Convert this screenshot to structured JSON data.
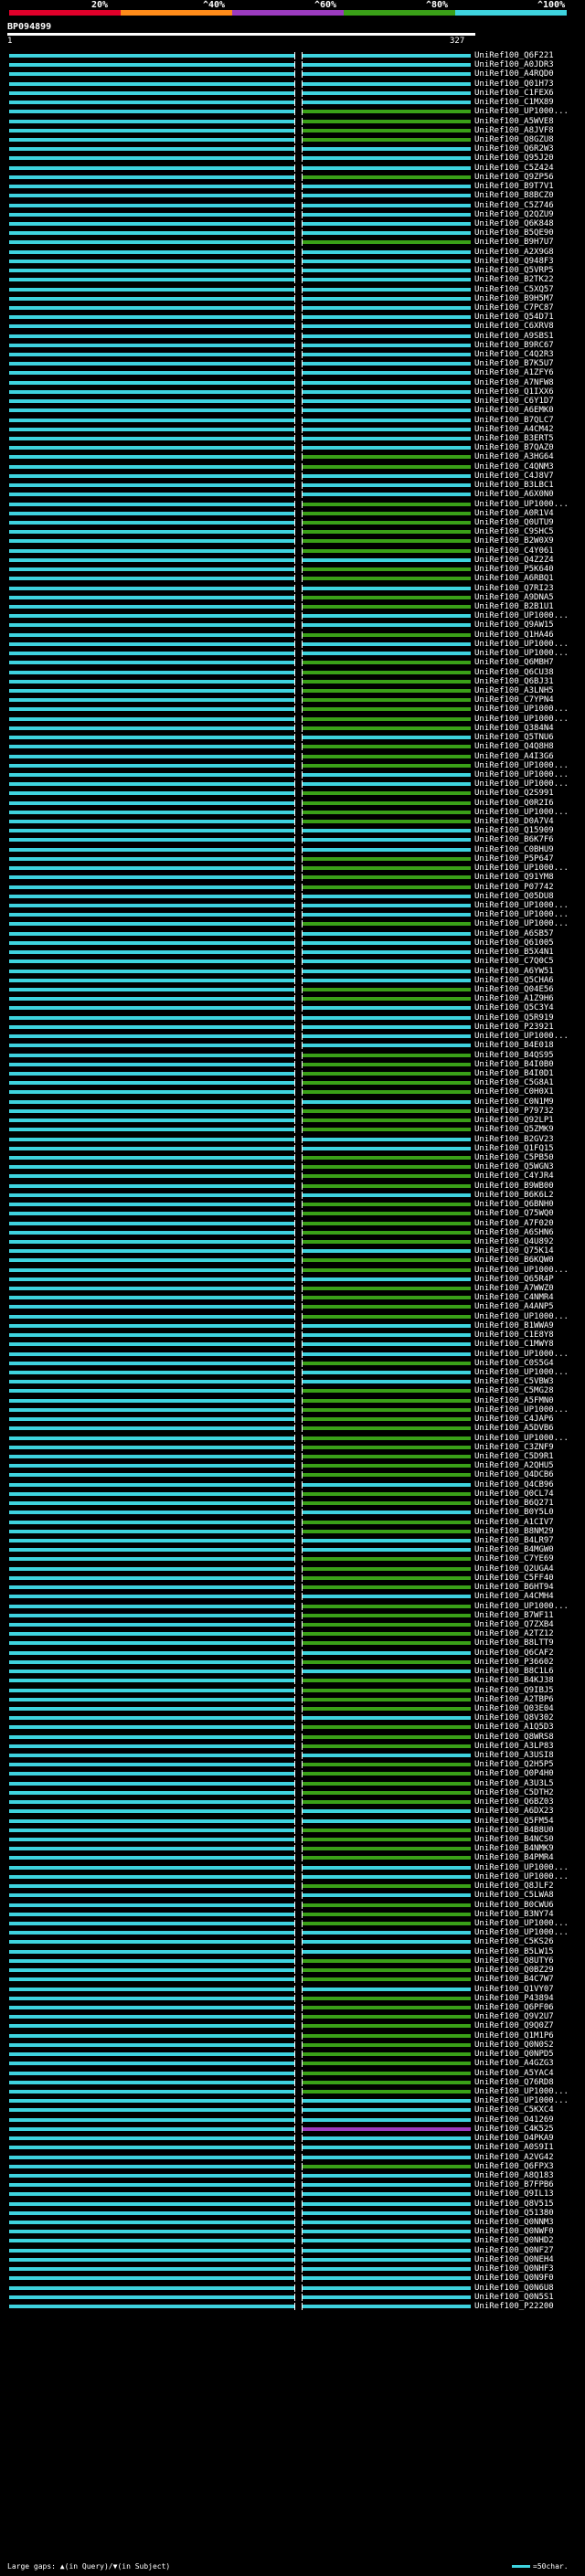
{
  "colors": {
    "background": "#000000",
    "scale": [
      "#e0002a",
      "#ff8c1a",
      "#9b3bbf",
      "#3aa018",
      "#3ed3de"
    ],
    "match_cyan": "#3ed3de",
    "match_green": "#3aa018",
    "match_purple": "#9b3bbf",
    "gap": "#000000"
  },
  "scale_labels": [
    "20%",
    "^40%",
    "^60%",
    "^80%",
    "^100%"
  ],
  "query": {
    "id": "BP094899",
    "start": "1",
    "end": "327"
  },
  "alignments": [
    {
      "label": "UniRef100_Q6F221",
      "color": "cyan"
    },
    {
      "label": "UniRef100_A0JDR3",
      "color": "cyan"
    },
    {
      "label": "UniRef100_A4RQD0",
      "color": "cyan"
    },
    {
      "label": "UniRef100_Q01H73",
      "color": "cyan"
    },
    {
      "label": "UniRef100_C1FEX6",
      "color": "cyan"
    },
    {
      "label": "UniRef100_C1MX89",
      "color": "cyan"
    },
    {
      "label": "UniRef100_UP1000...",
      "color": "green"
    },
    {
      "label": "UniRef100_A5WVE8",
      "color": "green"
    },
    {
      "label": "UniRef100_A8JVF8",
      "color": "green"
    },
    {
      "label": "UniRef100_Q8GZU8",
      "color": "green"
    },
    {
      "label": "UniRef100_Q6R2W3",
      "color": "cyan"
    },
    {
      "label": "UniRef100_Q95J20",
      "color": "cyan"
    },
    {
      "label": "UniRef100_C5Z424",
      "color": "cyan"
    },
    {
      "label": "UniRef100_Q9ZP56",
      "color": "green"
    },
    {
      "label": "UniRef100_B9T7V1",
      "color": "cyan"
    },
    {
      "label": "UniRef100_B8BCZ0",
      "color": "cyan"
    },
    {
      "label": "UniRef100_C5Z746",
      "color": "cyan"
    },
    {
      "label": "UniRef100_Q2QZU9",
      "color": "cyan"
    },
    {
      "label": "UniRef100_Q6K848",
      "color": "cyan"
    },
    {
      "label": "UniRef100_B5QE90",
      "color": "cyan"
    },
    {
      "label": "UniRef100_B9H7U7",
      "color": "green"
    },
    {
      "label": "UniRef100_A2X9G8",
      "color": "cyan"
    },
    {
      "label": "UniRef100_Q948F3",
      "color": "cyan"
    },
    {
      "label": "UniRef100_Q5VRP5",
      "color": "cyan"
    },
    {
      "label": "UniRef100_B2TK22",
      "color": "cyan"
    },
    {
      "label": "UniRef100_C5XQ57",
      "color": "cyan"
    },
    {
      "label": "UniRef100_B9H5M7",
      "color": "cyan"
    },
    {
      "label": "UniRef100_C7PC87",
      "color": "cyan"
    },
    {
      "label": "UniRef100_Q54D71",
      "color": "cyan"
    },
    {
      "label": "UniRef100_C6XRV8",
      "color": "cyan"
    },
    {
      "label": "UniRef100_A9SBS1",
      "color": "cyan"
    },
    {
      "label": "UniRef100_B9RC67",
      "color": "cyan"
    },
    {
      "label": "UniRef100_C4Q2R3",
      "color": "cyan"
    },
    {
      "label": "UniRef100_B7K5U7",
      "color": "cyan"
    },
    {
      "label": "UniRef100_A1ZFY6",
      "color": "cyan"
    },
    {
      "label": "UniRef100_A7NFW8",
      "color": "cyan"
    },
    {
      "label": "UniRef100_Q1IXX6",
      "color": "cyan"
    },
    {
      "label": "UniRef100_C6Y1D7",
      "color": "cyan"
    },
    {
      "label": "UniRef100_A6EMK0",
      "color": "cyan"
    },
    {
      "label": "UniRef100_B7QLC7",
      "color": "cyan"
    },
    {
      "label": "UniRef100_A4CM42",
      "color": "cyan"
    },
    {
      "label": "UniRef100_B3ERT5",
      "color": "cyan"
    },
    {
      "label": "UniRef100_B7QAZ0",
      "color": "cyan"
    },
    {
      "label": "UniRef100_A3HG64",
      "color": "green"
    },
    {
      "label": "UniRef100_C4QNM3",
      "color": "green"
    },
    {
      "label": "UniRef100_C4J8V7",
      "color": "cyan"
    },
    {
      "label": "UniRef100_B3LBC1",
      "color": "cyan"
    },
    {
      "label": "UniRef100_A6X0N0",
      "color": "cyan"
    },
    {
      "label": "UniRef100_UP1000...",
      "color": "green"
    },
    {
      "label": "UniRef100_A0R1V4",
      "color": "green"
    },
    {
      "label": "UniRef100_Q0UTU9",
      "color": "green"
    },
    {
      "label": "UniRef100_C9SHC5",
      "color": "green"
    },
    {
      "label": "UniRef100_B2W0X9",
      "color": "green"
    },
    {
      "label": "UniRef100_C4Y061",
      "color": "green"
    },
    {
      "label": "UniRef100_Q4Z2Z4",
      "color": "cyan"
    },
    {
      "label": "UniRef100_P5K640",
      "color": "green"
    },
    {
      "label": "UniRef100_A6RBQ1",
      "color": "green"
    },
    {
      "label": "UniRef100_Q7RI23",
      "color": "cyan"
    },
    {
      "label": "UniRef100_A9DNA5",
      "color": "green"
    },
    {
      "label": "UniRef100_B2B1U1",
      "color": "green"
    },
    {
      "label": "UniRef100_UP1000...",
      "color": "cyan"
    },
    {
      "label": "UniRef100_Q9AW15",
      "color": "cyan"
    },
    {
      "label": "UniRef100_Q1HA46",
      "color": "green"
    },
    {
      "label": "UniRef100_UP1000...",
      "color": "cyan"
    },
    {
      "label": "UniRef100_UP1000...",
      "color": "cyan"
    },
    {
      "label": "UniRef100_Q6MBH7",
      "color": "green"
    },
    {
      "label": "UniRef100_Q6CU38",
      "color": "green"
    },
    {
      "label": "UniRef100_Q6BJ31",
      "color": "green"
    },
    {
      "label": "UniRef100_A3LNH5",
      "color": "green"
    },
    {
      "label": "UniRef100_C7YPN4",
      "color": "green"
    },
    {
      "label": "UniRef100_UP1000...",
      "color": "green"
    },
    {
      "label": "UniRef100_UP1000...",
      "color": "green"
    },
    {
      "label": "UniRef100_Q384N4",
      "color": "green"
    },
    {
      "label": "UniRef100_Q5TNU6",
      "color": "cyan"
    },
    {
      "label": "UniRef100_Q4Q8H8",
      "color": "green"
    },
    {
      "label": "UniRef100_A4I3G6",
      "color": "green"
    },
    {
      "label": "UniRef100_UP1000...",
      "color": "green"
    },
    {
      "label": "UniRef100_UP1000...",
      "color": "cyan"
    },
    {
      "label": "UniRef100_UP1000...",
      "color": "cyan"
    },
    {
      "label": "UniRef100_Q2S991",
      "color": "green"
    },
    {
      "label": "UniRef100_Q0R2I6",
      "color": "green"
    },
    {
      "label": "UniRef100_UP1000...",
      "color": "green"
    },
    {
      "label": "UniRef100_D0A7V4",
      "color": "green"
    },
    {
      "label": "UniRef100_Q15909",
      "color": "cyan"
    },
    {
      "label": "UniRef100_B6K7F6",
      "color": "cyan"
    },
    {
      "label": "UniRef100_C0BHU9",
      "color": "cyan"
    },
    {
      "label": "UniRef100_P5P647",
      "color": "green"
    },
    {
      "label": "UniRef100_UP1000...",
      "color": "green"
    },
    {
      "label": "UniRef100_Q91YM8",
      "color": "green"
    },
    {
      "label": "UniRef100_P07742",
      "color": "green"
    },
    {
      "label": "UniRef100_Q05DU8",
      "color": "cyan"
    },
    {
      "label": "UniRef100_UP1000...",
      "color": "cyan"
    },
    {
      "label": "UniRef100_UP1000...",
      "color": "cyan"
    },
    {
      "label": "UniRef100_UP1000...",
      "color": "green"
    },
    {
      "label": "UniRef100_A6SB57",
      "color": "cyan"
    },
    {
      "label": "UniRef100_Q61005",
      "color": "cyan"
    },
    {
      "label": "UniRef100_B5X4N1",
      "color": "cyan"
    },
    {
      "label": "UniRef100_C7Q0C5",
      "color": "cyan"
    },
    {
      "label": "UniRef100_A6YW51",
      "color": "cyan"
    },
    {
      "label": "UniRef100_Q5CHA6",
      "color": "cyan"
    },
    {
      "label": "UniRef100_Q04E56",
      "color": "green"
    },
    {
      "label": "UniRef100_A1Z9H6",
      "color": "green"
    },
    {
      "label": "UniRef100_Q5C3Y4",
      "color": "cyan"
    },
    {
      "label": "UniRef100_Q5R919",
      "color": "cyan"
    },
    {
      "label": "UniRef100_P23921",
      "color": "cyan"
    },
    {
      "label": "UniRef100_UP1000...",
      "color": "cyan"
    },
    {
      "label": "UniRef100_B4E018",
      "color": "cyan"
    },
    {
      "label": "UniRef100_B4QS95",
      "color": "green"
    },
    {
      "label": "UniRef100_B4I0B0",
      "color": "green"
    },
    {
      "label": "UniRef100_B4I0D1",
      "color": "green"
    },
    {
      "label": "UniRef100_C5G8A1",
      "color": "green"
    },
    {
      "label": "UniRef100_C0H0X1",
      "color": "green"
    },
    {
      "label": "UniRef100_C0N1M9",
      "color": "cyan"
    },
    {
      "label": "UniRef100_P79732",
      "color": "green"
    },
    {
      "label": "UniRef100_Q92LP1",
      "color": "green"
    },
    {
      "label": "UniRef100_Q5ZMK9",
      "color": "green"
    },
    {
      "label": "UniRef100_B2GV23",
      "color": "cyan"
    },
    {
      "label": "UniRef100_Q1FQ15",
      "color": "cyan"
    },
    {
      "label": "UniRef100_C5PB50",
      "color": "green"
    },
    {
      "label": "UniRef100_Q5WGN3",
      "color": "green"
    },
    {
      "label": "UniRef100_C4YJR4",
      "color": "green"
    },
    {
      "label": "UniRef100_B9WB00",
      "color": "green"
    },
    {
      "label": "UniRef100_B6K6L2",
      "color": "cyan"
    },
    {
      "label": "UniRef100_Q6BNH0",
      "color": "green"
    },
    {
      "label": "UniRef100_Q75WQ0",
      "color": "green"
    },
    {
      "label": "UniRef100_A7F020",
      "color": "green"
    },
    {
      "label": "UniRef100_A6SHN6",
      "color": "green"
    },
    {
      "label": "UniRef100_Q4U892",
      "color": "green"
    },
    {
      "label": "UniRef100_Q75K14",
      "color": "cyan"
    },
    {
      "label": "UniRef100_B6KQW0",
      "color": "green"
    },
    {
      "label": "UniRef100_UP1000...",
      "color": "green"
    },
    {
      "label": "UniRef100_Q65R4P",
      "color": "cyan"
    },
    {
      "label": "UniRef100_A7WWZ0",
      "color": "green"
    },
    {
      "label": "UniRef100_C4NMR4",
      "color": "green"
    },
    {
      "label": "UniRef100_A4ANP5",
      "color": "green"
    },
    {
      "label": "UniRef100_UP1000...",
      "color": "green"
    },
    {
      "label": "UniRef100_B1WWA9",
      "color": "cyan"
    },
    {
      "label": "UniRef100_C1E8Y8",
      "color": "cyan"
    },
    {
      "label": "UniRef100_C1MWY8",
      "color": "cyan"
    },
    {
      "label": "UniRef100_UP1000...",
      "color": "cyan"
    },
    {
      "label": "UniRef100_C0S5G4",
      "color": "green"
    },
    {
      "label": "UniRef100_UP1000...",
      "color": "cyan"
    },
    {
      "label": "UniRef100_C5VBW3",
      "color": "cyan"
    },
    {
      "label": "UniRef100_C5MG28",
      "color": "green"
    },
    {
      "label": "UniRef100_A5FMN0",
      "color": "green"
    },
    {
      "label": "UniRef100_UP1000...",
      "color": "green"
    },
    {
      "label": "UniRef100_C4JAP6",
      "color": "green"
    },
    {
      "label": "UniRef100_A5DVB6",
      "color": "green"
    },
    {
      "label": "UniRef100_UP1000...",
      "color": "green"
    },
    {
      "label": "UniRef100_C3ZNF9",
      "color": "green"
    },
    {
      "label": "UniRef100_C5D9R1",
      "color": "green"
    },
    {
      "label": "UniRef100_A2QHU5",
      "color": "green"
    },
    {
      "label": "UniRef100_Q4DCB6",
      "color": "green"
    },
    {
      "label": "UniRef100_Q4CB96",
      "color": "cyan"
    },
    {
      "label": "UniRef100_Q0CL74",
      "color": "green"
    },
    {
      "label": "UniRef100_B6Q271",
      "color": "green"
    },
    {
      "label": "UniRef100_B0Y5L0",
      "color": "cyan"
    },
    {
      "label": "UniRef100_A1CIV7",
      "color": "green"
    },
    {
      "label": "UniRef100_B8NM29",
      "color": "green"
    },
    {
      "label": "UniRef100_B4LR97",
      "color": "cyan"
    },
    {
      "label": "UniRef100_B4MGW0",
      "color": "cyan"
    },
    {
      "label": "UniRef100_C7YE69",
      "color": "green"
    },
    {
      "label": "UniRef100_Q2UGA4",
      "color": "green"
    },
    {
      "label": "UniRef100_C5FF40",
      "color": "green"
    },
    {
      "label": "UniRef100_B6HT94",
      "color": "green"
    },
    {
      "label": "UniRef100_A4CMH4",
      "color": "cyan"
    },
    {
      "label": "UniRef100_UP1000...",
      "color": "green"
    },
    {
      "label": "UniRef100_B7WF11",
      "color": "green"
    },
    {
      "label": "UniRef100_Q7ZXB4",
      "color": "green"
    },
    {
      "label": "UniRef100_A2TZ12",
      "color": "green"
    },
    {
      "label": "UniRef100_B8LTT9",
      "color": "green"
    },
    {
      "label": "UniRef100_Q6CAF2",
      "color": "cyan"
    },
    {
      "label": "UniRef100_P36602",
      "color": "green"
    },
    {
      "label": "UniRef100_B8C1L6",
      "color": "cyan"
    },
    {
      "label": "UniRef100_B4KJ38",
      "color": "green"
    },
    {
      "label": "UniRef100_Q9IBJ5",
      "color": "green"
    },
    {
      "label": "UniRef100_A2TBP6",
      "color": "green"
    },
    {
      "label": "UniRef100_Q03E04",
      "color": "green"
    },
    {
      "label": "UniRef100_Q8V302",
      "color": "cyan"
    },
    {
      "label": "UniRef100_A1Q5D3",
      "color": "green"
    },
    {
      "label": "UniRef100_Q8WRS8",
      "color": "green"
    },
    {
      "label": "UniRef100_A3LP83",
      "color": "green"
    },
    {
      "label": "UniRef100_A3USI8",
      "color": "cyan"
    },
    {
      "label": "UniRef100_Q2H5P5",
      "color": "green"
    },
    {
      "label": "UniRef100_Q0P4H0",
      "color": "green"
    },
    {
      "label": "UniRef100_A3U3L5",
      "color": "green"
    },
    {
      "label": "UniRef100_C5DTH2",
      "color": "green"
    },
    {
      "label": "UniRef100_Q6BZ03",
      "color": "green"
    },
    {
      "label": "UniRef100_A6DX23",
      "color": "cyan"
    },
    {
      "label": "UniRef100_Q5FM54",
      "color": "cyan"
    },
    {
      "label": "UniRef100_B4B8U0",
      "color": "green"
    },
    {
      "label": "UniRef100_B4NCS0",
      "color": "green"
    },
    {
      "label": "UniRef100_B4NMK9",
      "color": "green"
    },
    {
      "label": "UniRef100_B4PMR4",
      "color": "green"
    },
    {
      "label": "UniRef100_UP1000...",
      "color": "cyan"
    },
    {
      "label": "UniRef100_UP1000...",
      "color": "cyan"
    },
    {
      "label": "UniRef100_Q8JLF2",
      "color": "green"
    },
    {
      "label": "UniRef100_C5LWA8",
      "color": "cyan"
    },
    {
      "label": "UniRef100_B0CWU6",
      "color": "green"
    },
    {
      "label": "UniRef100_B3NY74",
      "color": "green"
    },
    {
      "label": "UniRef100_UP1000...",
      "color": "green"
    },
    {
      "label": "UniRef100_UP1000...",
      "color": "cyan"
    },
    {
      "label": "UniRef100_C5KS26",
      "color": "cyan"
    },
    {
      "label": "UniRef100_B5LW15",
      "color": "cyan"
    },
    {
      "label": "UniRef100_Q8UTY6",
      "color": "green"
    },
    {
      "label": "UniRef100_Q0BZ29",
      "color": "green"
    },
    {
      "label": "UniRef100_B4C7W7",
      "color": "green"
    },
    {
      "label": "UniRef100_Q1VY07",
      "color": "cyan"
    },
    {
      "label": "UniRef100_P43894",
      "color": "green"
    },
    {
      "label": "UniRef100_Q6PF06",
      "color": "green"
    },
    {
      "label": "UniRef100_Q9V2U7",
      "color": "green"
    },
    {
      "label": "UniRef100_Q9Q0Z7",
      "color": "green"
    },
    {
      "label": "UniRef100_Q1M1P6",
      "color": "green"
    },
    {
      "label": "UniRef100_Q0N0S2",
      "color": "green"
    },
    {
      "label": "UniRef100_Q0NPD5",
      "color": "green"
    },
    {
      "label": "UniRef100_A4GZG3",
      "color": "green"
    },
    {
      "label": "UniRef100_A5YAC4",
      "color": "green"
    },
    {
      "label": "UniRef100_Q76RD8",
      "color": "green"
    },
    {
      "label": "UniRef100_UP1000...",
      "color": "green"
    },
    {
      "label": "UniRef100_UP1000...",
      "color": "cyan"
    },
    {
      "label": "UniRef100_C5KXC4",
      "color": "cyan"
    },
    {
      "label": "UniRef100_O41269",
      "color": "cyan"
    },
    {
      "label": "UniRef100_C4K525",
      "color": "purple"
    },
    {
      "label": "UniRef100_O4PKA9",
      "color": "cyan"
    },
    {
      "label": "UniRef100_A0S9I1",
      "color": "cyan"
    },
    {
      "label": "UniRef100_A2VG42",
      "color": "cyan"
    },
    {
      "label": "UniRef100_Q6FPX3",
      "color": "green"
    },
    {
      "label": "UniRef100_A8Q183",
      "color": "cyan"
    },
    {
      "label": "UniRef100_B7FPB6",
      "color": "cyan"
    },
    {
      "label": "UniRef100_Q9IL13",
      "color": "cyan"
    },
    {
      "label": "UniRef100_Q8V515",
      "color": "cyan"
    },
    {
      "label": "UniRef100_Q51380",
      "color": "cyan"
    },
    {
      "label": "UniRef100_Q0NNM3",
      "color": "cyan"
    },
    {
      "label": "UniRef100_Q0NWF0",
      "color": "cyan"
    },
    {
      "label": "UniRef100_Q0NHD2",
      "color": "cyan"
    },
    {
      "label": "UniRef100_Q0NF27",
      "color": "cyan"
    },
    {
      "label": "UniRef100_Q0NEH4",
      "color": "cyan"
    },
    {
      "label": "UniRef100_Q0NHF3",
      "color": "cyan"
    },
    {
      "label": "UniRef100_Q0N9F0",
      "color": "cyan"
    },
    {
      "label": "UniRef100_Q0N6U8",
      "color": "cyan"
    },
    {
      "label": "UniRef100_Q0N5S1",
      "color": "cyan"
    },
    {
      "label": "UniRef100_P22200",
      "color": "cyan"
    }
  ],
  "footer": {
    "large_gaps_label": "Large gaps: ",
    "query_gap_label": "(in Query)/",
    "subject_gap_label": "(in Subject)",
    "scale_label": "=50char."
  }
}
